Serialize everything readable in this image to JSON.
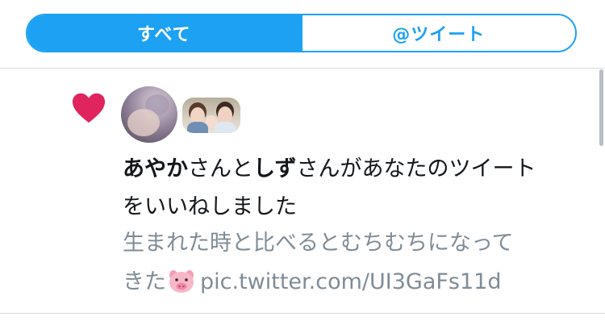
{
  "tabs": {
    "all_label": "すべて",
    "tweets_label": "@ツイート"
  },
  "notification": {
    "user1": "あやか",
    "connector1": "さんと",
    "user2": "しず",
    "action": "さんがあなたのツイート",
    "action_cont": "をいいねしました",
    "tweet_line1": "生まれた時と比べるとむちむちになって",
    "tweet_line2_start": "きた",
    "tweet_link": "pic.twitter.com/UI3GaFs11d",
    "icon_like": "heart-icon",
    "icon_emoji": "pig-face-icon"
  },
  "colors": {
    "accent": "#1da1f2",
    "like": "#e0245e",
    "text": "#14171a",
    "muted": "#7f8c97"
  }
}
